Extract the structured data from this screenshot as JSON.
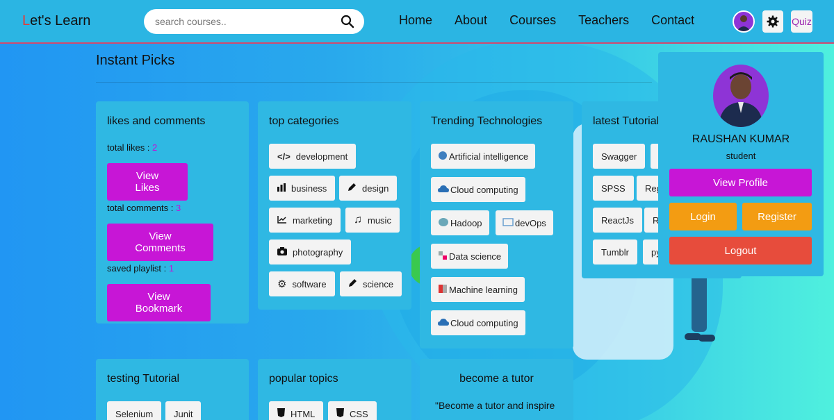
{
  "header": {
    "logo_first": "L",
    "logo_rest": "et's Learn",
    "search_placeholder": "search courses..",
    "nav": [
      "Home",
      "About",
      "Courses",
      "Teachers",
      "Contact"
    ],
    "quiz_label": "Quiz"
  },
  "section_title": "Instant Picks",
  "likes_card": {
    "title": "likes and comments",
    "likes_label": "total likes : ",
    "likes_count": "2",
    "view_likes": "View Likes",
    "comments_label": "total comments : ",
    "comments_count": "3",
    "view_comments": "View Comments",
    "playlist_label": "saved playlist : ",
    "playlist_count": "1",
    "view_bookmark": "View Bookmark"
  },
  "categories_card": {
    "title": "top categories",
    "items": [
      "development",
      "business",
      "design",
      "marketing",
      "music",
      "photography",
      "software",
      "science"
    ]
  },
  "trending_card": {
    "title": "Trending Technologies",
    "items": [
      "Artificial intelligence",
      "Cloud computing",
      "Hadoop",
      "devOps",
      "Data science",
      "Machine learning",
      "Cloud computing"
    ]
  },
  "latest_card": {
    "title": "latest Tutorials",
    "items": [
      "Swagger",
      "SPSS",
      "Reg",
      "ReactJs",
      "R",
      "Tumblr",
      "py"
    ]
  },
  "testing_card": {
    "title": "testing Tutorial",
    "items": [
      "Selenium",
      "Junit"
    ]
  },
  "popular_card": {
    "title": "popular topics",
    "items": [
      "HTML",
      "CSS"
    ]
  },
  "tutor_card": {
    "title": "become a tutor",
    "quote": "\"Become a tutor and inspire"
  },
  "profile": {
    "name": "RAUSHAN KUMAR",
    "role": "student",
    "view_profile": "View Profile",
    "login": "Login",
    "register": "Register",
    "logout": "Logout"
  },
  "colors": {
    "accent_magenta": "#c716d6",
    "login_orange": "#f39c12",
    "logout_red": "#e74c3c",
    "card_bg": "#2fb8e3"
  }
}
